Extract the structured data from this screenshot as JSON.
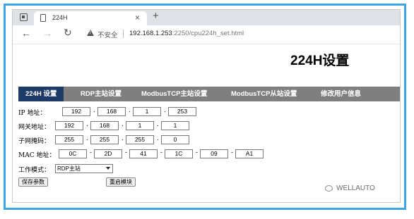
{
  "browser": {
    "tab_title": "224H",
    "tab_close": "×",
    "new_tab": "+",
    "back": "←",
    "forward": "→",
    "reload": "↻",
    "insecure_label": "不安全",
    "url_host": "192.168.1.253",
    "url_rest": ":2250/cpu224h_set.html"
  },
  "page": {
    "heading": "224H设置",
    "nav": [
      {
        "label": "224H 设置",
        "active": true
      },
      {
        "label": "RDP主站设置"
      },
      {
        "label": "ModbusTCP主站设置"
      },
      {
        "label": "ModbusTCP从站设置"
      },
      {
        "label": "修改用户信息"
      }
    ],
    "ip": {
      "label": "IP   地址：",
      "values": [
        "192",
        "168",
        "1",
        "253"
      ]
    },
    "gateway": {
      "label": "网关地址：",
      "values": [
        "192",
        "168",
        "1",
        "1"
      ]
    },
    "subnet": {
      "label": "子网掩码：",
      "values": [
        "255",
        "255",
        "255",
        "0"
      ]
    },
    "mac": {
      "label": "MAC  地址：",
      "values": [
        "0C",
        "2D",
        "41",
        "1C",
        "09",
        "A1"
      ]
    },
    "mode": {
      "label": "工作模式：",
      "selected": "RDP主站"
    },
    "save_button": "保存参数",
    "restart_button": "重启模块"
  },
  "watermark": "WELLAUTO"
}
